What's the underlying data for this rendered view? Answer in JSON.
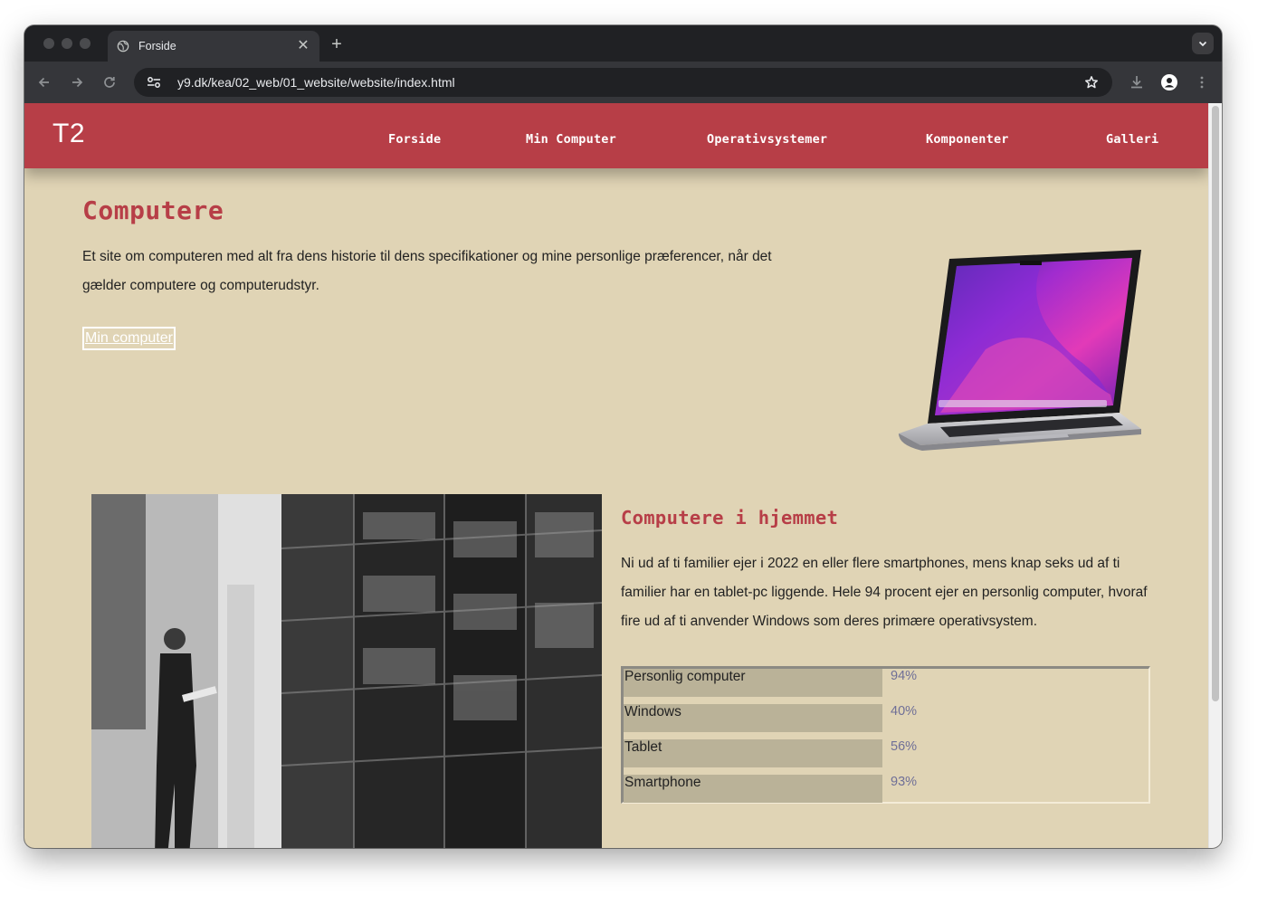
{
  "browser": {
    "tab_title": "Forside",
    "url": "y9.dk/kea/02_web/01_website/website/index.html"
  },
  "site": {
    "logo": "T2",
    "nav": [
      "Forside",
      "Min Computer",
      "Operativsystemer",
      "Komponenter",
      "Galleri"
    ],
    "accent_color": "#b73e47",
    "background_color": "#e0d4b5"
  },
  "hero": {
    "title": "Computere",
    "text": "Et site om computeren med alt fra dens historie til dens specifikationer og mine personlige præferencer, når det gælder computere og computerudstyr.",
    "button": "Min computer"
  },
  "section": {
    "title": "Computere i hjemmet",
    "text": "Ni ud af ti familier ejer i 2022 en eller flere smartphones, mens knap seks ud af ti familier har en tablet-pc liggende. Hele 94 procent ejer en personlig computer, hvoraf fire ud af ti anvender Windows som deres primære operativsystem."
  },
  "stats": [
    {
      "label": "Personlig computer",
      "value": "94%"
    },
    {
      "label": "Windows",
      "value": "40%"
    },
    {
      "label": "Tablet",
      "value": "56%"
    },
    {
      "label": "Smartphone",
      "value": "93%"
    }
  ]
}
